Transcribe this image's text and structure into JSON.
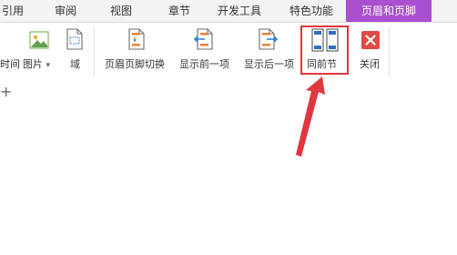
{
  "tabs": [
    {
      "label": "引用"
    },
    {
      "label": "审阅"
    },
    {
      "label": "视图"
    },
    {
      "label": "章节"
    },
    {
      "label": "开发工具"
    },
    {
      "label": "特色功能"
    },
    {
      "label": "页眉和页脚",
      "active": true
    }
  ],
  "ribbon": {
    "time_partial": "时间",
    "picture": "图片",
    "picture_caret": "▾",
    "field": "域",
    "switch": "页眉页脚切换",
    "show_prev": "显示前一项",
    "show_next": "显示后一项",
    "same_as_prev": "同前节",
    "close": "关闭"
  },
  "add_symbol": "+",
  "colors": {
    "active_tab": "#a94fd0",
    "highlight": "#e2363e",
    "close_red": "#e24a4a",
    "arrow_blue": "#2f7fd8",
    "doc_orange": "#e8823a"
  }
}
